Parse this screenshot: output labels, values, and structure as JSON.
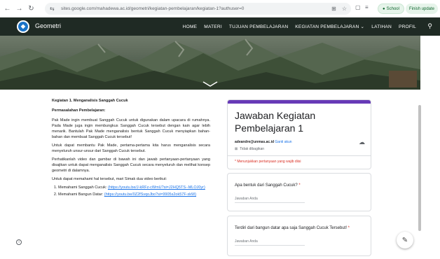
{
  "browser": {
    "url": "sites.google.com/mahadewa.ac.id/geometri/kegiatan-pembelajaran/kegiatan-1?authuser=0",
    "school_label": "School",
    "finish_update_label": "Finish update"
  },
  "site": {
    "title": "Geometri",
    "nav": [
      "HOME",
      "MATERI",
      "TUJUAN PEMBELAJARAN",
      "KEGIATAN PEMBELAJARAN ⌄",
      "LATIHAN",
      "PROFIL"
    ]
  },
  "content": {
    "heading": "Kegiatan 1. Menganalisis Sanggah Cucuk",
    "subheading": "Permasalahan Pembelajaran:",
    "para1": "Pak Made ingin membuat Sanggah Cucuk untuk digunakan dalam upacara di rumahnya. Pada Made juga ingin membungkus Sanggah Cucuk tersebut dengan kain agar lebih menarik. Bantulah Pak Made menganalisis bentuk Sanggah Cucuk menyiapkan bahan-bahan dan membuat Sanggah Cucuk tersebut!",
    "para2": "Untuk dapat membantu Pak Made, pertama-pertama kita harus menganalisis secara menyeluruh unsur-unsur dari Sanggah Cucuk tersebut.",
    "para3": "Perhatikanlah video dan gambar di bawah ini dan jawab pertanyaan-pertanyaan yang disajikan untuk dapat menganalisis Sanggah Cucuk secara menyeluruh dan melihat konsep geometri di dalamnya.",
    "para4": "Untuk dapat memahami hal tersebut, mari Simak dua video berikut:",
    "list": [
      {
        "text": "Memahami Sanggah Cucuk: ",
        "link": "(https://youtu.be/J-kRFz-cWmU?si=J2HQ5TS--MLOJ0yr)"
      },
      {
        "text": "Memahami Bangun Datar: ",
        "link": "(https://youtu.be/0Z2fSvqoJbo?si=9905s2ok57F-xkW)"
      }
    ]
  },
  "form": {
    "title": "Jawaban Kegiatan Pembelajaran 1",
    "email": "adeandre@unmas.ac.id",
    "switch_account": "Ganti akun",
    "not_shared": "Tidak dibagikan",
    "required_note": "* Menunjukkan pertanyaan yang wajib diisi",
    "questions": [
      {
        "label": "Apa bentuk dari Sanggah Cucuk?",
        "placeholder": "Jawaban Anda"
      },
      {
        "label": "Terdiri dari bangun datar apa saja Sanggah Cucuk Tersebut!",
        "placeholder": "Jawaban Anda"
      }
    ]
  },
  "colors": {
    "form_accent": "#673ab7",
    "header_bg": "#1f2a24",
    "required": "#d93025",
    "link": "#1a73e8"
  }
}
